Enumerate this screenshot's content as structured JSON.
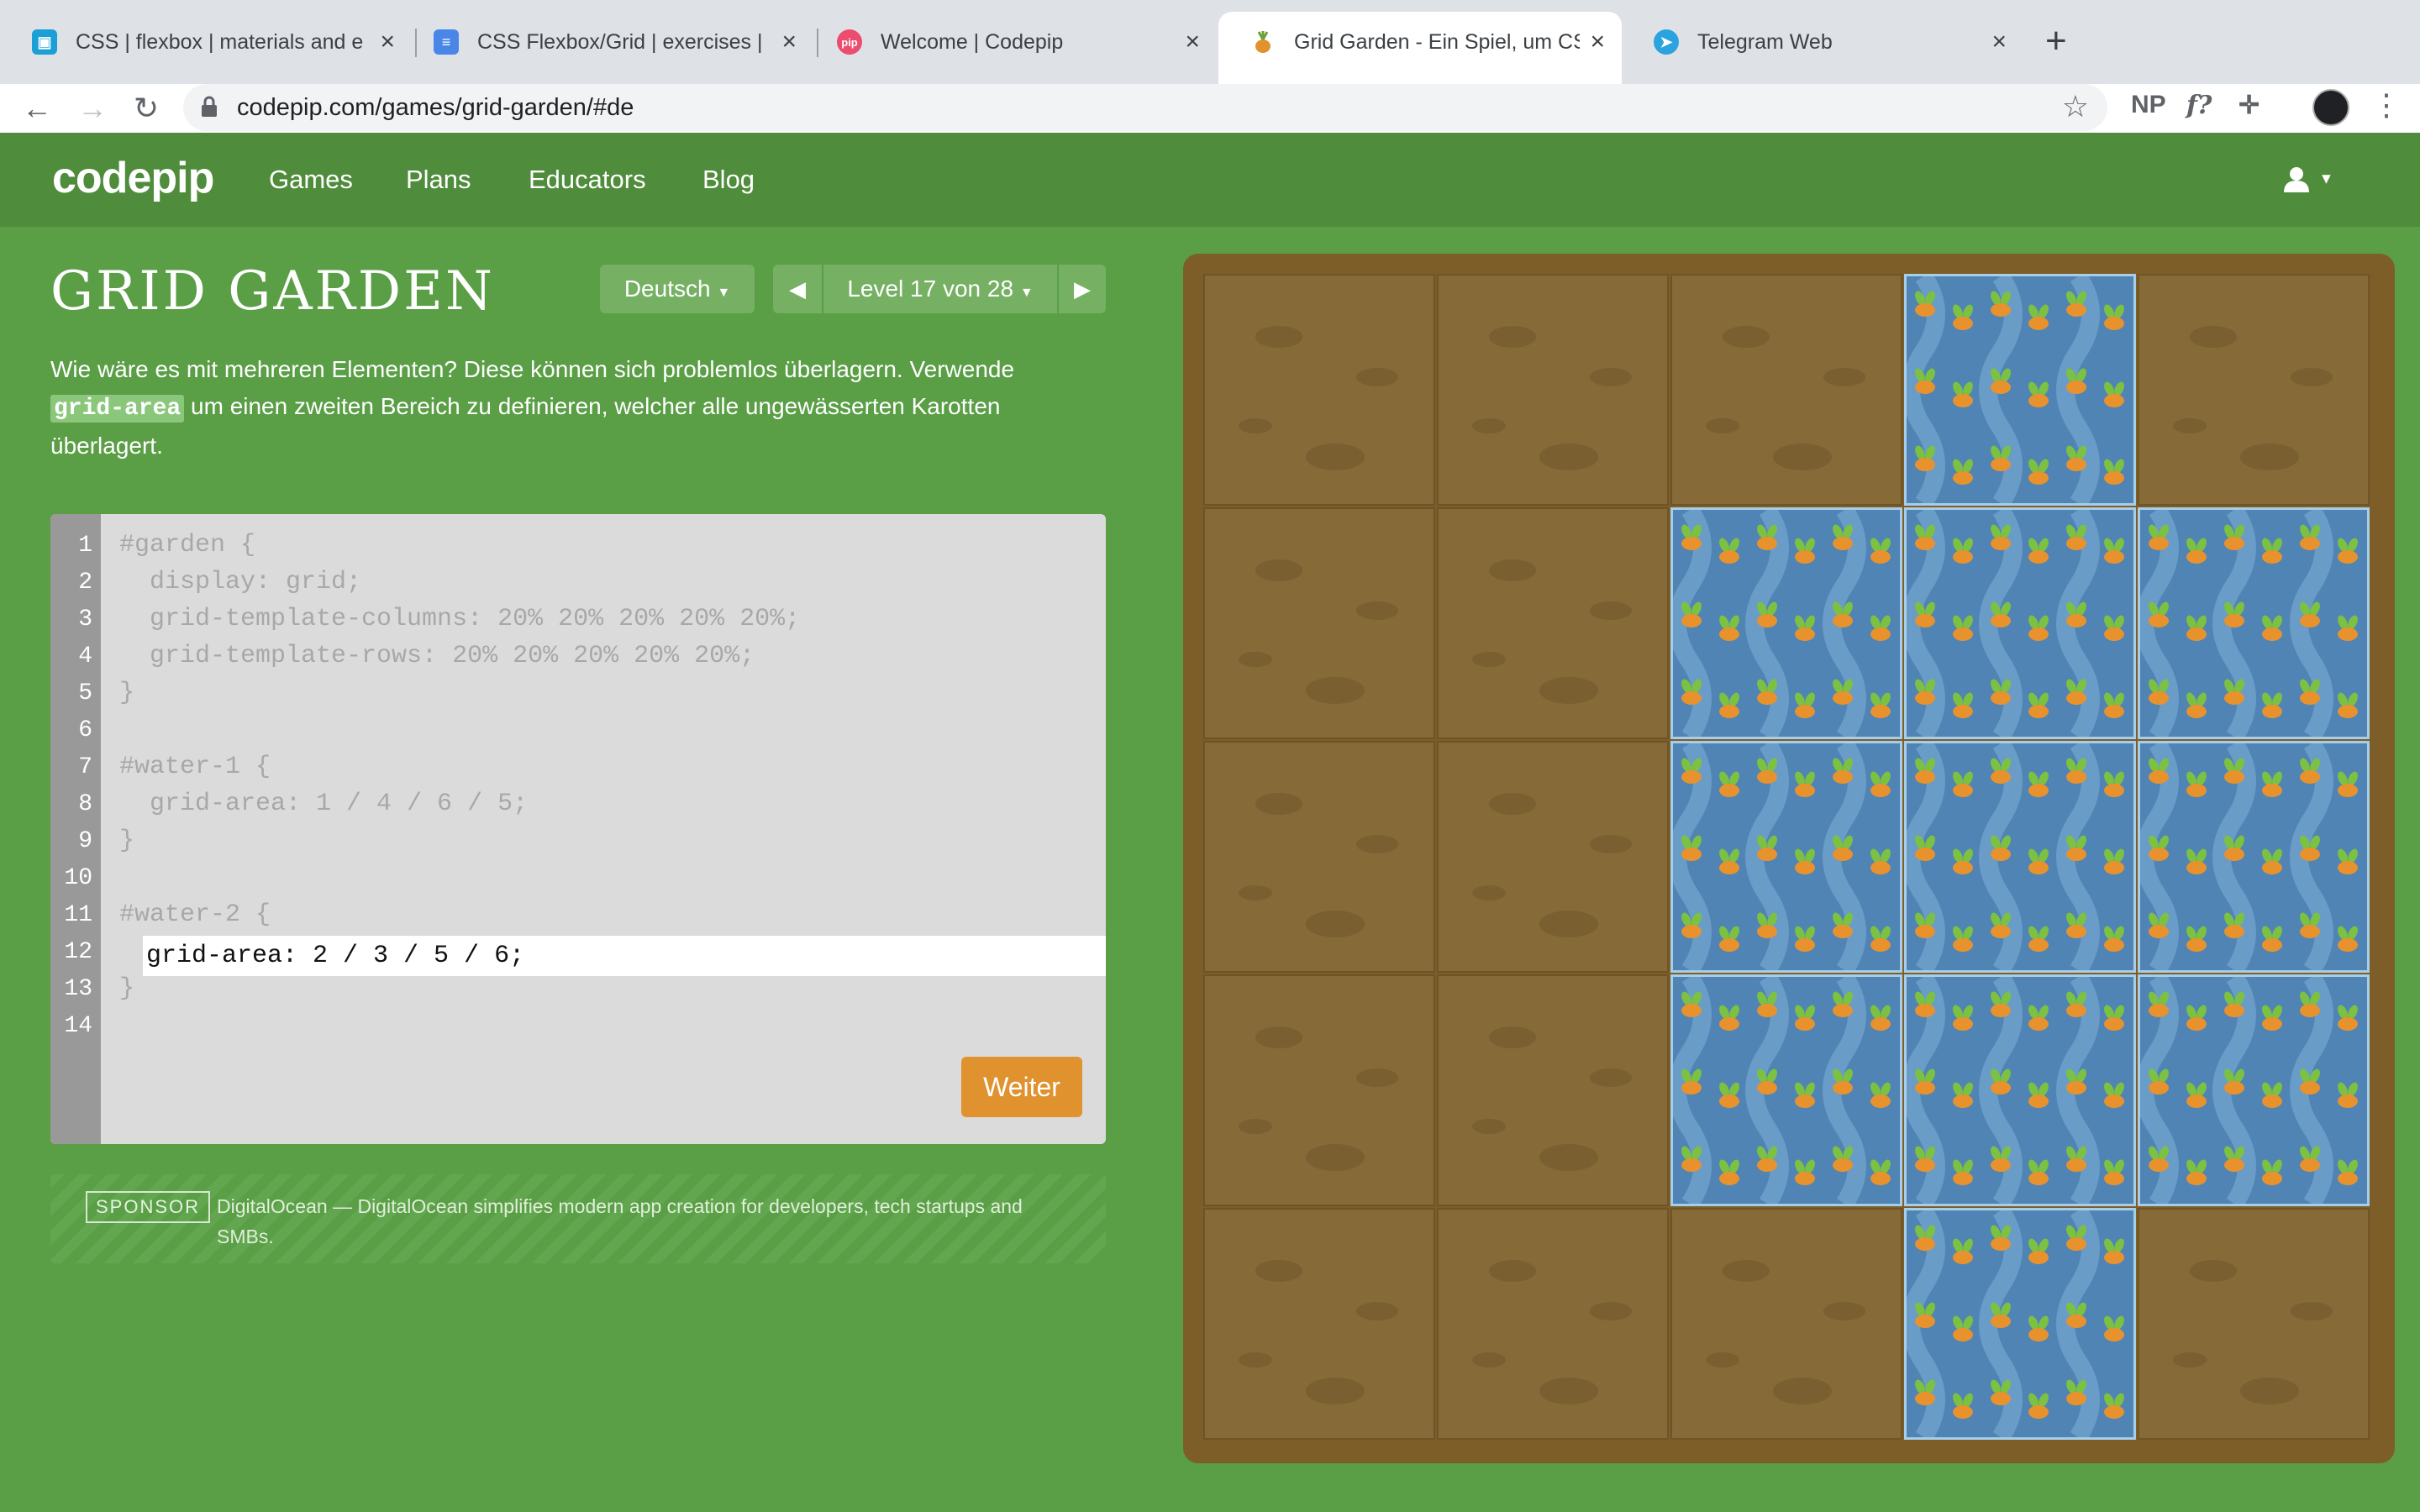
{
  "browser": {
    "tabs": [
      {
        "title": "CSS | flexbox | materials and e",
        "favicon": "classroom-icon",
        "color": "#1a9fd6"
      },
      {
        "title": "CSS Flexbox/Grid | exercises | ",
        "favicon": "docs-icon",
        "color": "#4a86e8"
      },
      {
        "title": "Welcome | Codepip",
        "favicon": "codepip-icon",
        "color": "#ec4c6e"
      },
      {
        "title": "Grid Garden - Ein Spiel, um CS",
        "favicon": "carrot-icon",
        "color": "#e0922f"
      },
      {
        "title": "Telegram Web",
        "favicon": "telegram-icon",
        "color": "#2aa3df"
      }
    ],
    "active_tab": 3,
    "url": "codepip.com/games/grid-garden/#de",
    "extensions": [
      "NP",
      "f?"
    ]
  },
  "site": {
    "logo": "codepip",
    "nav": [
      "Games",
      "Plans",
      "Educators",
      "Blog"
    ]
  },
  "game": {
    "title": "GRID GARDEN",
    "language": "Deutsch",
    "level": "Level 17 von 28",
    "instructions_1": "Wie wäre es mit mehreren Elementen? Diese können sich problemlos überlagern. Verwende",
    "instructions_code": "grid-area",
    "instructions_2": "um einen zweiten Bereich zu definieren, welcher alle ungewässerten Karotten überlagert.",
    "code_lines": [
      "#garden {",
      "  display: grid;",
      "  grid-template-columns: 20% 20% 20% 20% 20%;",
      "  grid-template-rows: 20% 20% 20% 20% 20%;",
      "}",
      "",
      "#water-1 {",
      "  grid-area: 1 / 4 / 6 / 5;",
      "}",
      "",
      "#water-2 {",
      "",
      "}",
      ""
    ],
    "line_numbers": [
      "1",
      "2",
      "3",
      "4",
      "5",
      "6",
      "7",
      "8",
      "9",
      "10",
      "11",
      "12",
      "13",
      "14"
    ],
    "input_value": "grid-area: 2 / 3 / 5 / 6;",
    "submit_label": "Weiter",
    "sponsor_badge": "SPONSOR",
    "sponsor_text": "DigitalOcean — DigitalOcean simplifies modern app creation for developers, tech startups and SMBs."
  },
  "garden": {
    "rows": 5,
    "cols": 5,
    "watered_cells": [
      [
        1,
        4
      ],
      [
        2,
        3
      ],
      [
        2,
        4
      ],
      [
        2,
        5
      ],
      [
        3,
        3
      ],
      [
        3,
        4
      ],
      [
        3,
        5
      ],
      [
        4,
        3
      ],
      [
        4,
        4
      ],
      [
        4,
        5
      ],
      [
        5,
        4
      ]
    ],
    "colors": {
      "dirt": "#866a38",
      "water": "#4f84b5",
      "frame": "#7d5e28",
      "carrot": "#e8922e",
      "leaf": "#7cc142"
    }
  },
  "colors": {
    "background": "#5a9e46",
    "header": "#4f8c3b",
    "button": "#75b063",
    "submit": "#e0922f"
  }
}
